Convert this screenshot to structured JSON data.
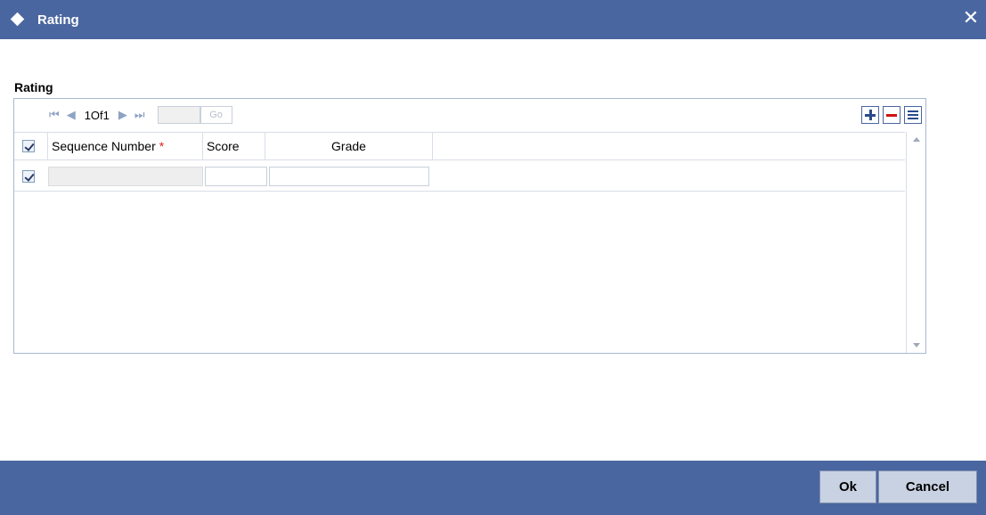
{
  "window": {
    "title": "Rating",
    "close_symbol": "✕"
  },
  "section": {
    "label": "Rating"
  },
  "pager": {
    "page_info": "1Of1",
    "go_label": "Go",
    "page_value": ""
  },
  "table": {
    "columns": [
      {
        "label": "Sequence Number",
        "required": true
      },
      {
        "label": "Score",
        "required": false
      },
      {
        "label": "Grade",
        "required": false
      }
    ],
    "required_marker": "*",
    "rows": [
      {
        "checked": true,
        "sequence_number": "",
        "score": "",
        "grade": ""
      }
    ]
  },
  "footer": {
    "ok_label": "Ok",
    "cancel_label": "Cancel"
  },
  "colors": {
    "title_bar": "#4a66a0",
    "footer": "#4a66a0",
    "required": "#e02020"
  }
}
